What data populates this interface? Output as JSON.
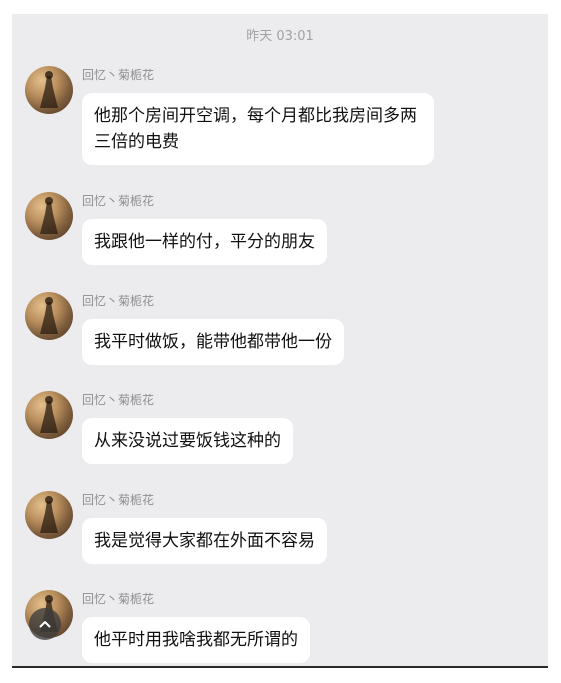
{
  "chat": {
    "timestamp": "昨天 03:01",
    "messages": [
      {
        "sender": "回忆丶菊栀花",
        "text": "他那个房间开空调，每个月都比我房间多两三倍的电费"
      },
      {
        "sender": "回忆丶菊栀花",
        "text": "我跟他一样的付，平分的朋友"
      },
      {
        "sender": "回忆丶菊栀花",
        "text": "我平时做饭，能带他都带他一份"
      },
      {
        "sender": "回忆丶菊栀花",
        "text": "从来没说过要饭钱这种的"
      },
      {
        "sender": "回忆丶菊栀花",
        "text": "我是觉得大家都在外面不容易"
      },
      {
        "sender": "回忆丶菊栀花",
        "text": "他平时用我啥我都无所谓的"
      }
    ],
    "scroll_button_icon": "chevron-up-icon"
  }
}
